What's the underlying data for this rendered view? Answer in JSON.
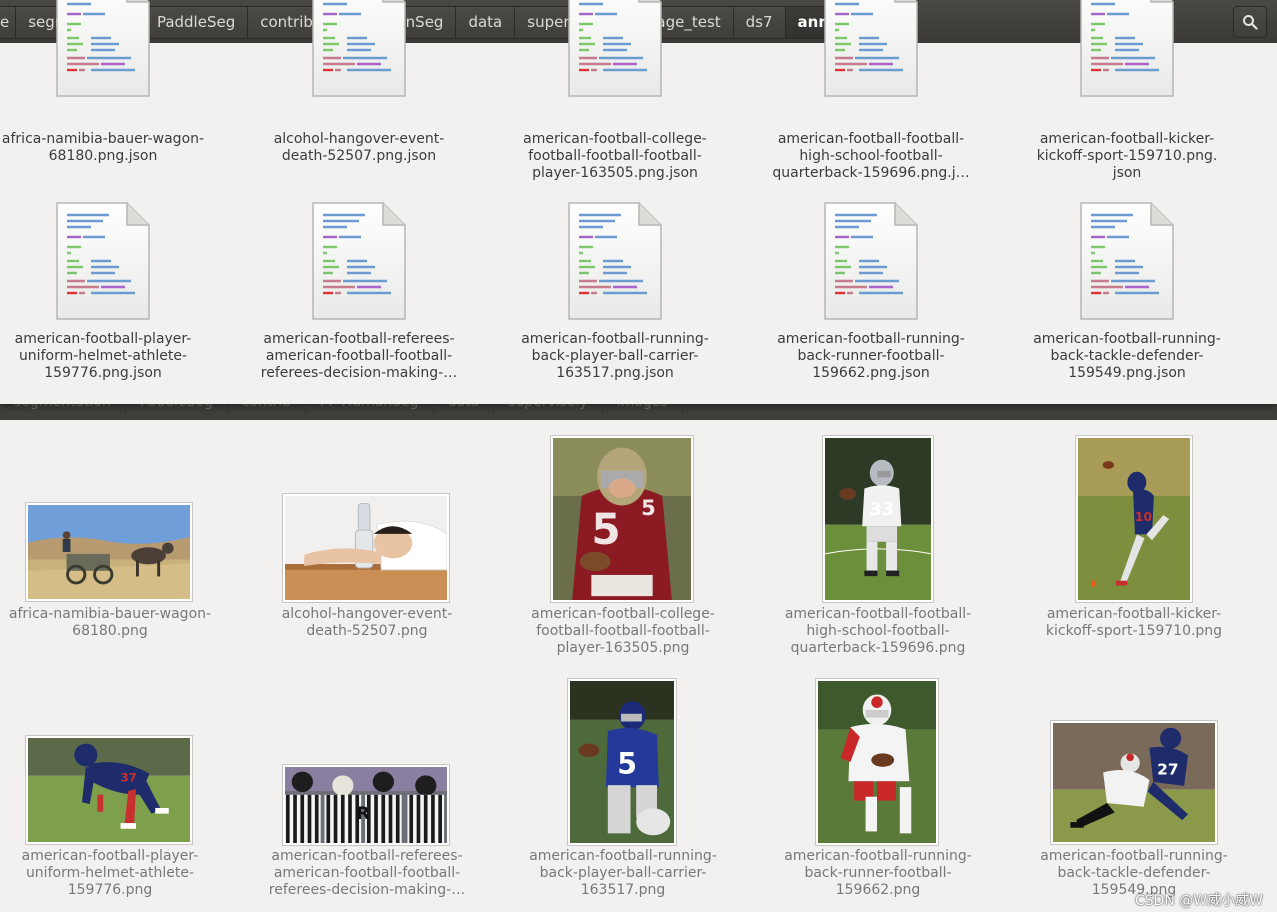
{
  "breadcrumbs": {
    "items": [
      "e",
      "segmentation",
      "PaddleSeg",
      "contrib",
      "PP-HumanSeg",
      "data",
      "supervisely",
      "image_test",
      "ds7",
      "ann"
    ],
    "active": "ann"
  },
  "json_files": [
    {
      "line1": "africa-namibia-bauer-wagon-",
      "line2": "68180.png.json",
      "line3": ""
    },
    {
      "line1": "alcohol-hangover-event-",
      "line2": "death-52507.png.json",
      "line3": ""
    },
    {
      "line1": "american-football-college-",
      "line2": "football-football-football-",
      "line3": "player-163505.png.json"
    },
    {
      "line1": "american-football-football-",
      "line2": "high-school-football-",
      "line3": "quarterback-159696.png.j…"
    },
    {
      "line1": "american-football-kicker-",
      "line2": "kickoff-sport-159710.png.",
      "line3": "json"
    },
    {
      "line1": "american-football-player-",
      "line2": "uniform-helmet-athlete-",
      "line3": "159776.png.json"
    },
    {
      "line1": "american-football-referees-",
      "line2": "american-football-football-",
      "line3": "referees-decision-making-…"
    },
    {
      "line1": "american-football-running-",
      "line2": "back-player-ball-carrier-",
      "line3": "163517.png.json"
    },
    {
      "line1": "american-football-running-",
      "line2": "back-runner-football-",
      "line3": "159662.png.json"
    },
    {
      "line1": "american-football-running-",
      "line2": "back-tackle-defender-",
      "line3": "159549.png.json"
    }
  ],
  "ghost_breadcrumbs": [
    "segmentation",
    "PaddleSeg",
    "contrib",
    "PP-HumanSeg",
    "data",
    "supervisely",
    "images"
  ],
  "png_files": [
    {
      "line1": "africa-namibia-bauer-wagon-",
      "line2": "68180.png",
      "line3": ""
    },
    {
      "line1": "alcohol-hangover-event-",
      "line2": "death-52507.png",
      "line3": ""
    },
    {
      "line1": "american-football-college-",
      "line2": "football-football-football-",
      "line3": "player-163505.png"
    },
    {
      "line1": "american-football-football-",
      "line2": "high-school-football-",
      "line3": "quarterback-159696.png"
    },
    {
      "line1": "american-football-kicker-",
      "line2": "kickoff-sport-159710.png",
      "line3": ""
    },
    {
      "line1": "american-football-player-",
      "line2": "uniform-helmet-athlete-",
      "line3": "159776.png"
    },
    {
      "line1": "american-football-referees-",
      "line2": "american-football-football-",
      "line3": "referees-decision-making-…"
    },
    {
      "line1": "american-football-running-",
      "line2": "back-player-ball-carrier-",
      "line3": "163517.png"
    },
    {
      "line1": "american-football-running-",
      "line2": "back-runner-football-",
      "line3": "159662.png"
    },
    {
      "line1": "american-football-running-",
      "line2": "back-tackle-defender-",
      "line3": "159549.png"
    }
  ],
  "watermark": "CSDN @W威小威W",
  "colors": {
    "pathbar": "#3c3b37",
    "window_bg": "#f2f1f0",
    "jersey_red": "#8b1a22",
    "jersey_blue": "#1e2c6b",
    "grass": "#6b8f3a"
  }
}
